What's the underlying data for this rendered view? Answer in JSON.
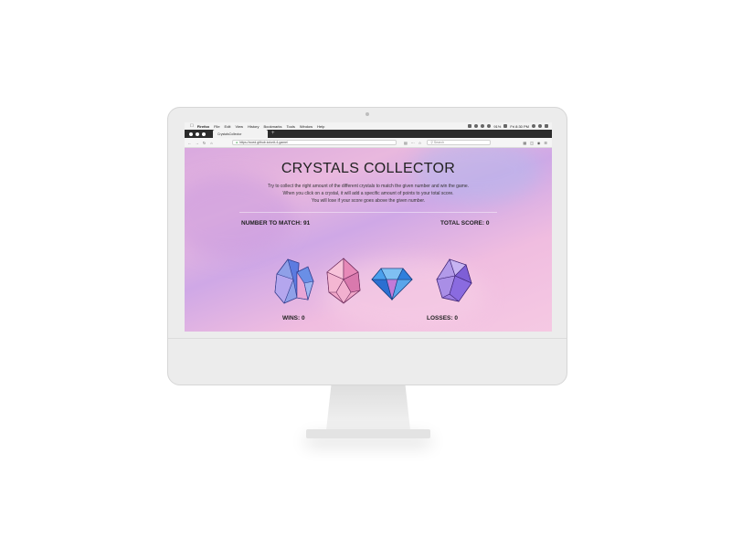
{
  "menubar": {
    "app": "Firefox",
    "items": [
      "File",
      "Edit",
      "View",
      "History",
      "Bookmarks",
      "Tools",
      "Window",
      "Help"
    ],
    "battery": "91%",
    "clock": "Fri 8:30 PM"
  },
  "browser": {
    "tab_title": "CrystalsCollector",
    "url": "https://zoed.github.io/unit-4-game/",
    "search_placeholder": "Search"
  },
  "game": {
    "title": "CRYSTALS COLLECTOR",
    "instructions": [
      "Try to collect the right amount of the different crystals to match the given number and win the game.",
      "When you click on a crystal, it will add a specific amount of points to your total score.",
      "You will lose if your score goes above the given number."
    ],
    "number_to_match": "NUMBER TO MATCH: 91",
    "total_score": "TOTAL SCORE: 0",
    "wins": "WINS: 0",
    "losses": "LOSSES: 0",
    "crystals": [
      "blue-purple-crystal-cluster",
      "pink-crystal",
      "blue-diamond",
      "purple-crystal"
    ]
  },
  "colors": {
    "page_gradient_start": "#d9a9df",
    "page_gradient_end": "#f5c9e3",
    "menubar_bg": "#f3f3f3",
    "tabbar_bg": "#2b2b2b",
    "bezel": "#ececec"
  }
}
